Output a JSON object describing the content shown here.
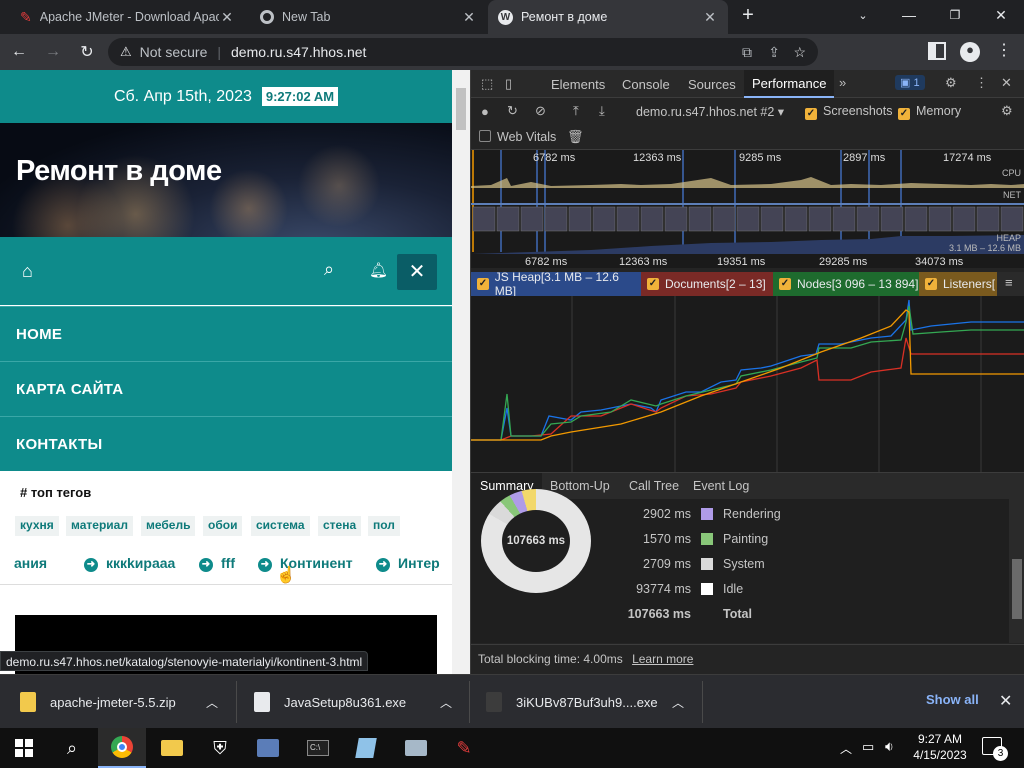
{
  "tabs": [
    {
      "title": "Apache JMeter - Download Apac",
      "icon": "feather-icon"
    },
    {
      "title": "New Tab",
      "icon": "chrome-icon"
    },
    {
      "title": "Ремонт в доме",
      "icon": "wordpress-icon"
    }
  ],
  "omnibox": {
    "security": "Not secure",
    "url": "demo.ru.s47.hhos.net"
  },
  "site": {
    "date": "Сб. Апр 15th, 2023",
    "time": "9:27:02 AM",
    "title": "Ремонт в доме",
    "menu": [
      "HOME",
      "КАРТА САЙТА",
      "КОНТАКТЫ"
    ],
    "tags_heading": "# топ тегов",
    "tags": [
      "кухня",
      "материал",
      "мебель",
      "обои",
      "система",
      "стена",
      "пол"
    ],
    "tag_links": [
      "ания",
      "кккkираaa",
      "fff",
      "Континент",
      "Интер"
    ]
  },
  "status_url": "demo.ru.s47.hhos.net/katalog/stenovyie-materialyi/kontinent-3.html",
  "devtools": {
    "tabs": [
      "Elements",
      "Console",
      "Sources",
      "Performance"
    ],
    "issues_count": "1",
    "recording": "demo.ru.s47.hhos.net #2",
    "options": [
      "Screenshots",
      "Memory",
      "Web Vitals"
    ],
    "overview_marks": [
      "6782 ms",
      "12363 ms",
      "9285 ms",
      "2897 ms",
      "17274 ms"
    ],
    "overview_labels": [
      "CPU",
      "NET",
      "HEAP",
      "3.1 MB – 12.6 MB"
    ],
    "ruler": [
      "6782 ms",
      "12363 ms",
      "19351 ms",
      "29285 ms",
      "34073 ms"
    ],
    "counters": [
      {
        "label": "JS Heap[3.1 MB – 12.6 MB]",
        "color": "#1a73e8"
      },
      {
        "label": "Documents[2 – 13]",
        "color": "#d93025"
      },
      {
        "label": "Nodes[3 096 – 13 894]",
        "color": "#188038"
      },
      {
        "label": "Listeners[",
        "color": "#e8a33a"
      }
    ],
    "bottom_tabs": [
      "Summary",
      "Bottom-Up",
      "Call Tree",
      "Event Log"
    ],
    "donut_total": "107663 ms",
    "summary": [
      {
        "value": "2902 ms",
        "name": "Rendering",
        "color": "#af9be8"
      },
      {
        "value": "1570 ms",
        "name": "Painting",
        "color": "#89c779"
      },
      {
        "value": "2709 ms",
        "name": "System",
        "color": "#dadada"
      },
      {
        "value": "93774 ms",
        "name": "Idle",
        "color": "#ffffff"
      },
      {
        "value": "107663 ms",
        "name": "Total",
        "color": ""
      }
    ],
    "footer_text": "Total blocking time: 4.00ms",
    "footer_link": "Learn more"
  },
  "downloads": {
    "items": [
      "apache-jmeter-5.5.zip",
      "JavaSetup8u361.exe",
      "3iKUBv87Buf3uh9....exe"
    ],
    "show_all": "Show all"
  },
  "taskbar": {
    "time": "9:27 AM",
    "date": "4/15/2023",
    "notifications": "3"
  }
}
